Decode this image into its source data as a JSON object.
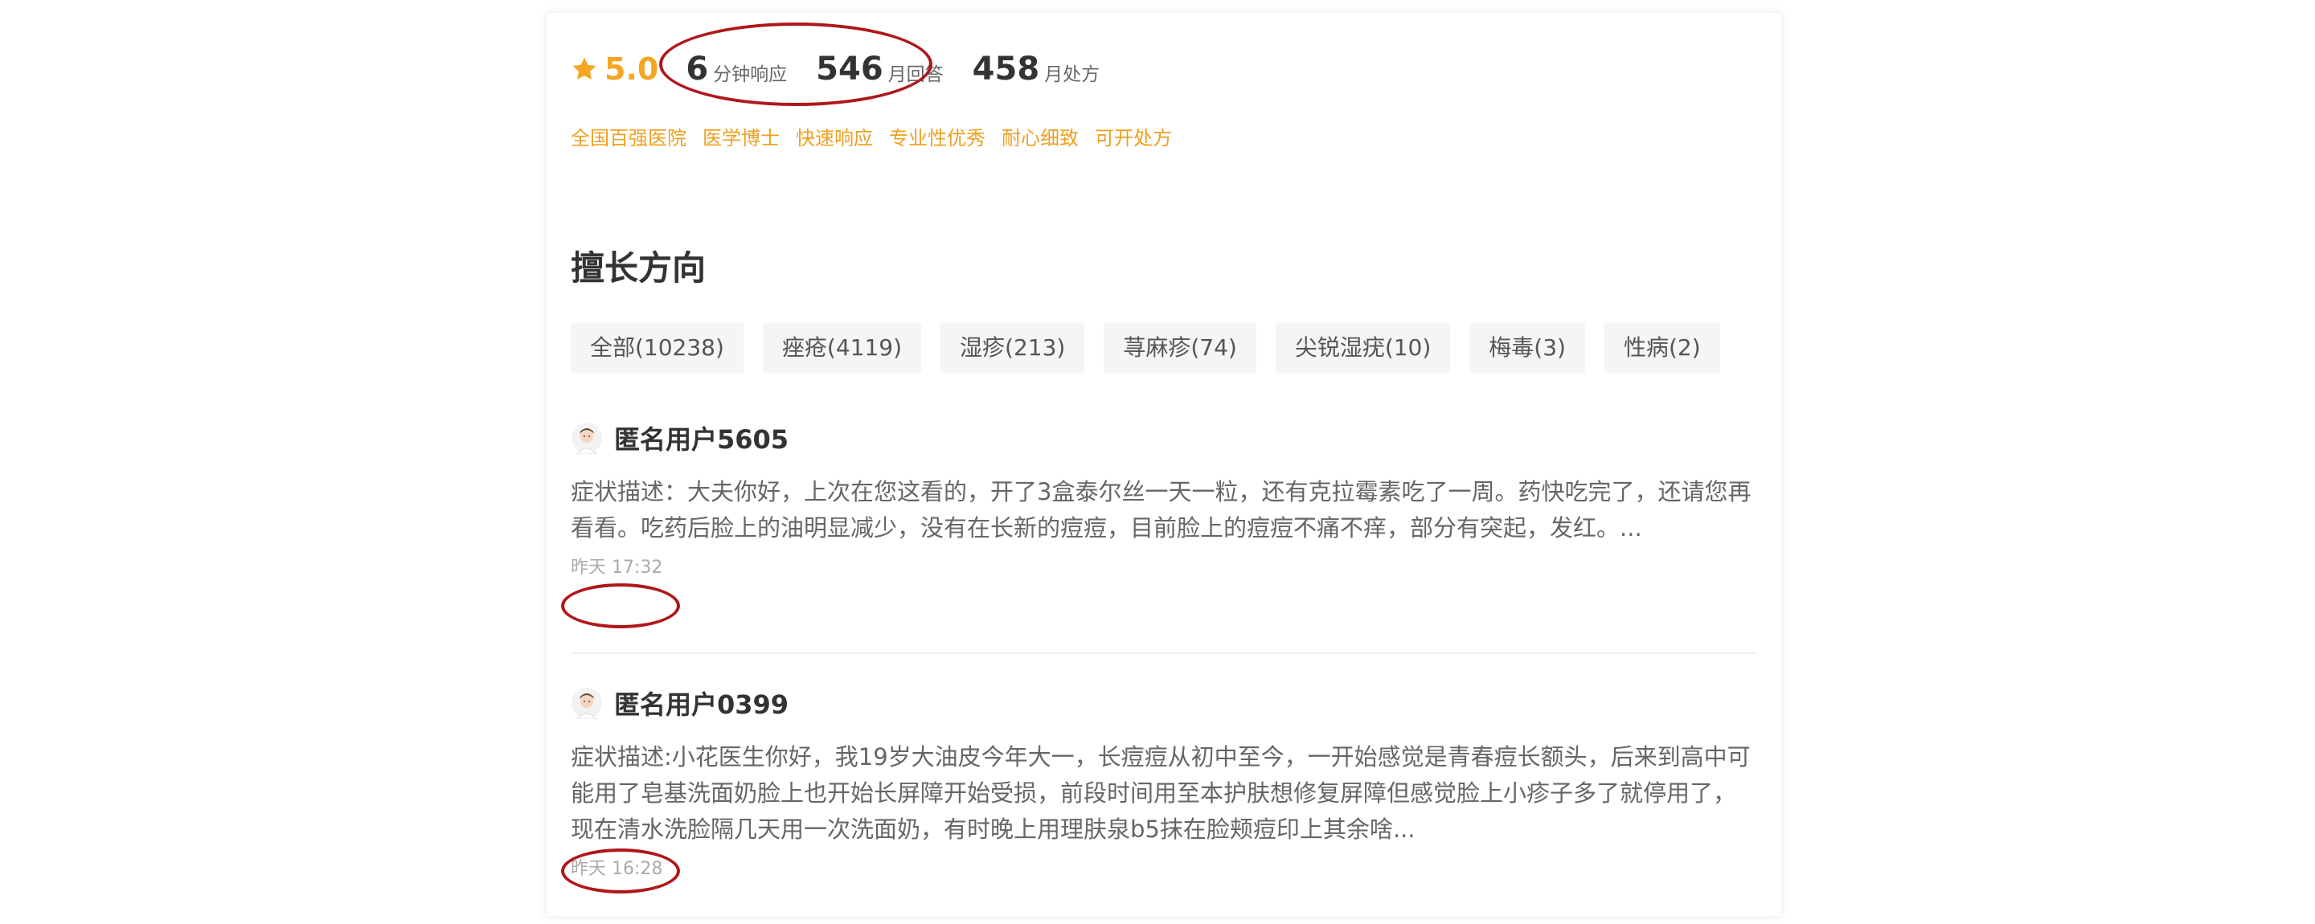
{
  "stats": {
    "rating": "5.0",
    "response_num": "6",
    "response_unit": "分钟响应",
    "answers_num": "546",
    "answers_unit": "月回答",
    "prescriptions_num": "458",
    "prescriptions_unit": "月处方"
  },
  "tags": [
    "全国百强医院",
    "医学博士",
    "快速响应",
    "专业性优秀",
    "耐心细致",
    "可开处方"
  ],
  "section_title": "擅长方向",
  "chips": [
    "全部(10238)",
    "痤疮(4119)",
    "湿疹(213)",
    "荨麻疹(74)",
    "尖锐湿疣(10)",
    "梅毒(3)",
    "性病(2)"
  ],
  "questions": [
    {
      "user": "匿名用户5605",
      "desc": "症状描述：大夫你好，上次在您这看的，开了3盒泰尔丝一天一粒，还有克拉霉素吃了一周。药快吃完了，还请您再看看。吃药后脸上的油明显减少，没有在长新的痘痘，目前脸上的痘痘不痛不痒，部分有突起，发红。...",
      "time": "昨天 17:32"
    },
    {
      "user": "匿名用户0399",
      "desc": "症状描述:小花医生你好，我19岁大油皮今年大一，长痘痘从初中至今，一开始感觉是青春痘长额头，后来到高中可能用了皂基洗面奶脸上也开始长屏障开始受损，前段时间用至本护肤想修复屏障但感觉脸上小疹子多了就停用了，现在清水洗脸隔几天用一次洗面奶，有时晚上用理肤泉b5抹在脸颊痘印上其余啥...",
      "time": "昨天 16:28"
    }
  ],
  "colors": {
    "accent": "#f5a623",
    "tag": "#f0a020",
    "annotation": "#b0171a"
  }
}
